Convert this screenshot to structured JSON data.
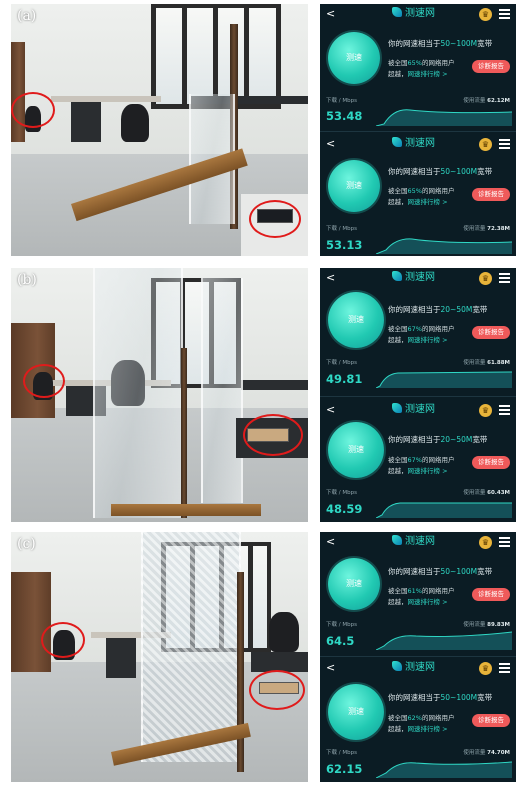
{
  "panels": [
    {
      "label": "(a)"
    },
    {
      "label": "(b)"
    },
    {
      "label": "(c)"
    }
  ],
  "screens": [
    {
      "results": [
        {
          "brand": "测速网",
          "orb": "测速",
          "line1a": "你的网速相当于",
          "line1b": "50~100M",
          "line1c": "宽带",
          "line2a": "被全国",
          "line2b": "65%",
          "line2c": "的网络用户",
          "line3a": "超越，",
          "line3b": "网速排行榜 >",
          "report": "诊断报告",
          "dl_label": "下载 / Mbps",
          "usage_label": "使用流量",
          "usage": "62.12M",
          "speed": "53.48"
        },
        {
          "brand": "测速网",
          "orb": "测速",
          "line1a": "你的网速相当于",
          "line1b": "50~100M",
          "line1c": "宽带",
          "line2a": "被全国",
          "line2b": "65%",
          "line2c": "的网络用户",
          "line3a": "超越，",
          "line3b": "网速排行榜 >",
          "report": "诊断报告",
          "dl_label": "下载 / Mbps",
          "usage_label": "使用流量",
          "usage": "72.38M",
          "speed": "53.13"
        }
      ]
    },
    {
      "results": [
        {
          "brand": "测速网",
          "orb": "测速",
          "line1a": "你的网速相当于",
          "line1b": "20~50M",
          "line1c": "宽带",
          "line2a": "被全国",
          "line2b": "67%",
          "line2c": "的网络用户",
          "line3a": "超越，",
          "line3b": "网速排行榜 >",
          "report": "诊断报告",
          "dl_label": "下载 / Mbps",
          "usage_label": "使用流量",
          "usage": "61.88M",
          "speed": "49.81"
        },
        {
          "brand": "测速网",
          "orb": "测速",
          "line1a": "你的网速相当于",
          "line1b": "20~50M",
          "line1c": "宽带",
          "line2a": "被全国",
          "line2b": "67%",
          "line2c": "的网络用户",
          "line3a": "超越，",
          "line3b": "网速排行榜 >",
          "report": "诊断报告",
          "dl_label": "下载 / Mbps",
          "usage_label": "使用流量",
          "usage": "60.43M",
          "speed": "48.59"
        }
      ]
    },
    {
      "results": [
        {
          "brand": "测速网",
          "orb": "测速",
          "line1a": "你的网速相当于",
          "line1b": "50~100M",
          "line1c": "宽带",
          "line2a": "被全国",
          "line2b": "61%",
          "line2c": "的网络用户",
          "line3a": "超越，",
          "line3b": "网速排行榜 >",
          "report": "诊断报告",
          "dl_label": "下载 / Mbps",
          "usage_label": "使用流量",
          "usage": "89.83M",
          "speed": "64.5"
        },
        {
          "brand": "测速网",
          "orb": "测速",
          "line1a": "你的网速相当于",
          "line1b": "50~100M",
          "line1c": "宽带",
          "line2a": "被全国",
          "line2b": "62%",
          "line2c": "的网络用户",
          "line3a": "超越，",
          "line3b": "网速排行榜 >",
          "report": "诊断报告",
          "dl_label": "下载 / Mbps",
          "usage_label": "使用流量",
          "usage": "74.70M",
          "speed": "62.15"
        }
      ]
    }
  ],
  "colors": {
    "accent": "#2fd8c5",
    "report": "#ef5a5a",
    "circle": "#e01b1b",
    "screen_bg": "#0b1c24"
  }
}
